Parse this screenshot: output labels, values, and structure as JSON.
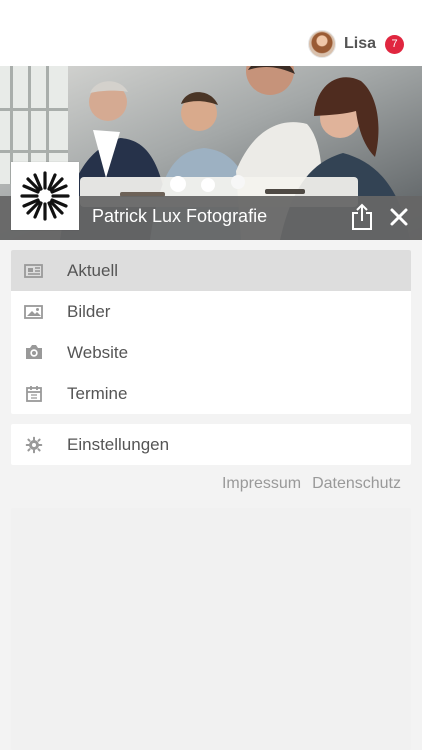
{
  "user": {
    "name": "Lisa",
    "notification_count": "7"
  },
  "header": {
    "title": "Patrick Lux Fotografie",
    "share_icon": "share-icon",
    "close_icon": "close-icon"
  },
  "menu": {
    "items": [
      {
        "label": "Aktuell",
        "icon": "newspaper-icon",
        "active": true
      },
      {
        "label": "Bilder",
        "icon": "image-icon",
        "active": false
      },
      {
        "label": "Website",
        "icon": "camera-icon",
        "active": false
      },
      {
        "label": "Termine",
        "icon": "calendar-icon",
        "active": false
      }
    ],
    "settings": {
      "label": "Einstellungen",
      "icon": "gear-icon"
    }
  },
  "footer": {
    "impressum": "Impressum",
    "datenschutz": "Datenschutz"
  },
  "colors": {
    "badge": "#e0263f",
    "title_bar": "#666666",
    "active_item": "#dddddd"
  }
}
